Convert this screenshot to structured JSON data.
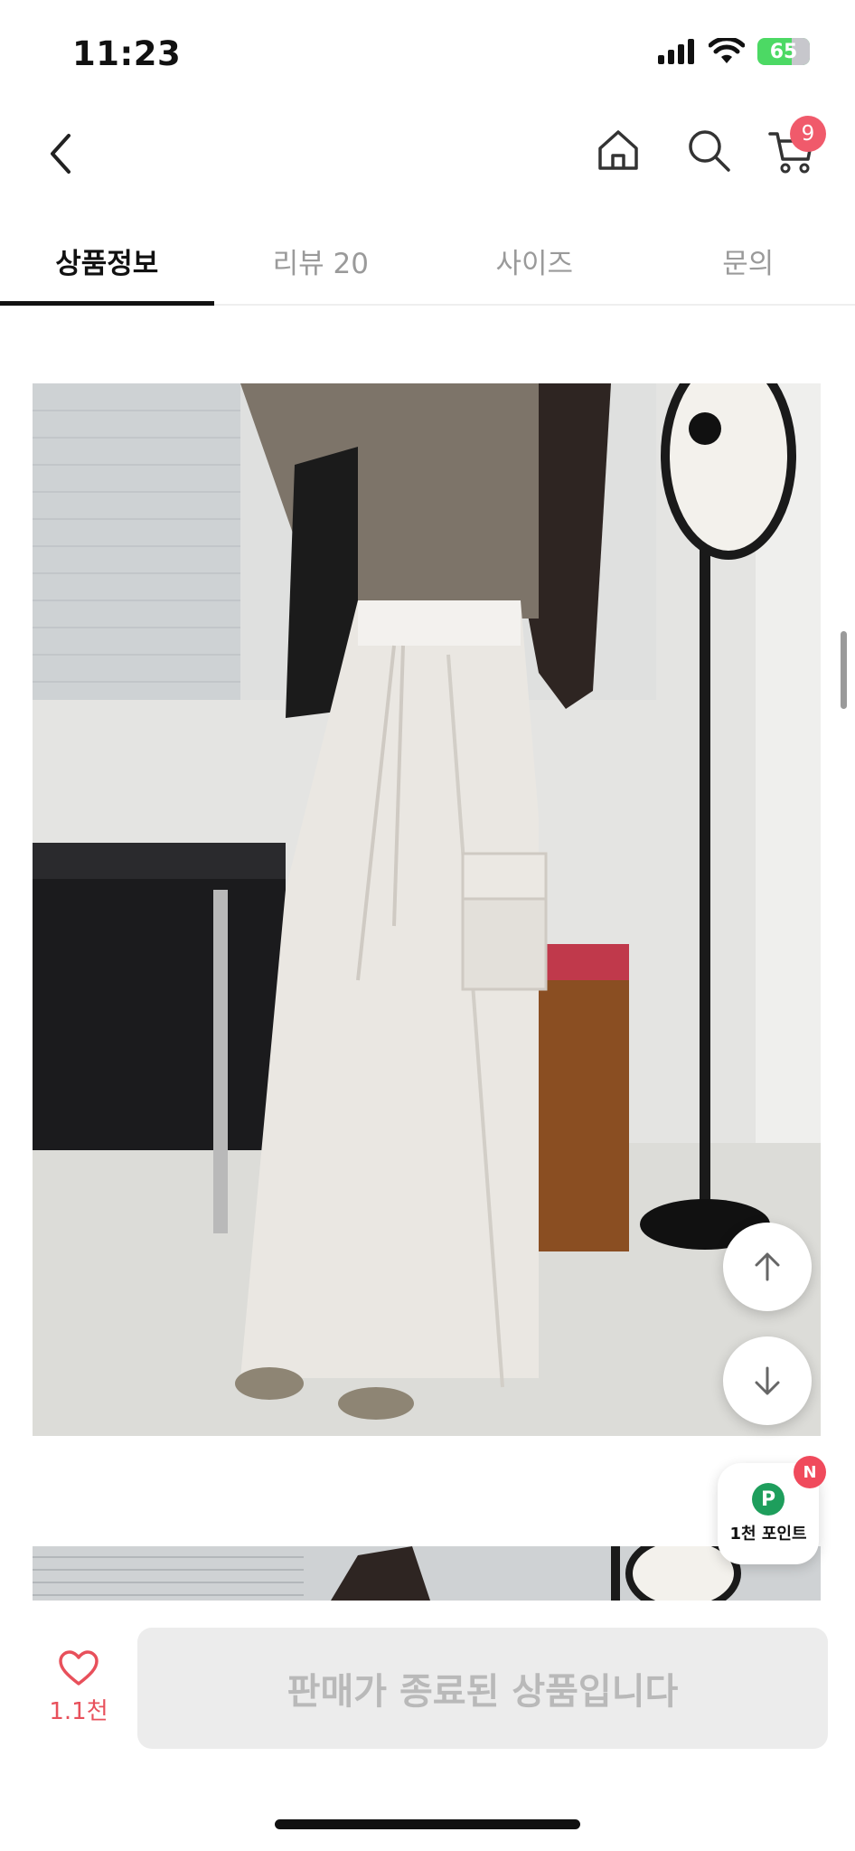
{
  "status_bar": {
    "time": "11:23",
    "battery": "65"
  },
  "header": {
    "cart_count": "9"
  },
  "tabs": [
    {
      "label": "상품정보",
      "active": true
    },
    {
      "label": "리뷰 20",
      "active": false
    },
    {
      "label": "사이즈",
      "active": false
    },
    {
      "label": "문의",
      "active": false
    }
  ],
  "points": {
    "icon_letter": "P",
    "label": "1천 포인트",
    "new_badge": "N"
  },
  "bottom": {
    "like_count": "1.1천",
    "buy_label": "판매가 종료된 상품입니다"
  },
  "colors": {
    "accent_red": "#e8505b",
    "badge_red": "#f05a6b",
    "points_green": "#1e9e5c"
  },
  "icons": [
    "back-chevron-icon",
    "home-icon",
    "search-icon",
    "cart-icon",
    "arrow-up-icon",
    "arrow-down-icon",
    "heart-icon",
    "signal-icon",
    "wifi-icon",
    "battery-icon"
  ]
}
